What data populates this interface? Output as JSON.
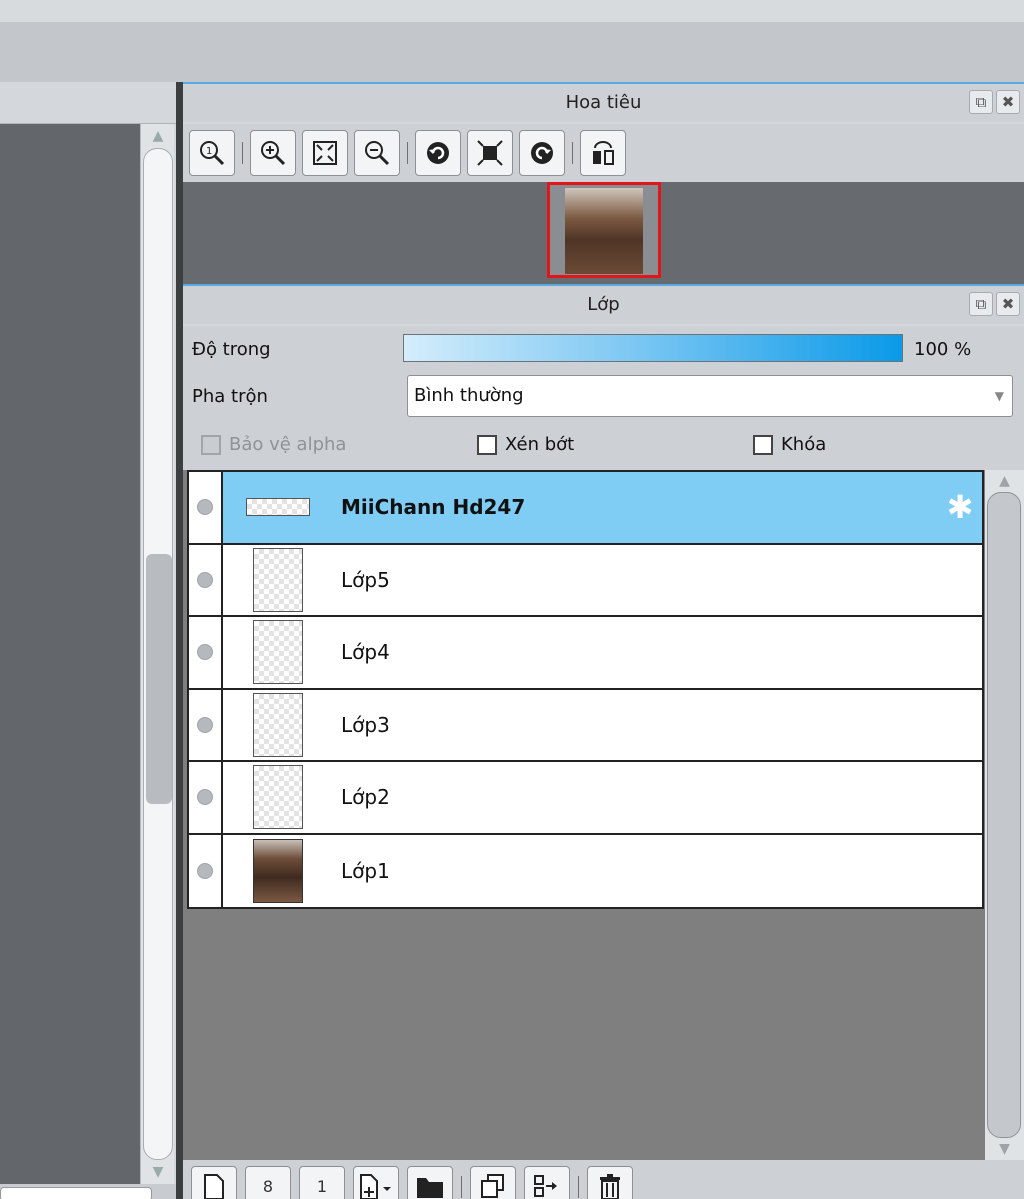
{
  "navigator": {
    "title": "Hoa tiêu",
    "toolbar": [
      "zoom-100-icon",
      "zoom-in-icon",
      "fit-window-icon",
      "zoom-out-icon",
      "rotate-left-icon",
      "fit-screen-icon",
      "rotate-right-icon",
      "flip-icon"
    ]
  },
  "layers_panel": {
    "title": "Lớp",
    "opacity_label": "Độ trong",
    "opacity_value": "100 %",
    "opacity_fraction": 1.0,
    "blend_label": "Pha trộn",
    "blend_value": "Bình thường",
    "protect_alpha_label": "Bảo vệ alpha",
    "clipping_label": "Xén bớt",
    "lock_label": "Khóa",
    "layers": [
      {
        "name": "MiiChann Hd247",
        "selected": true,
        "thumb": "wide"
      },
      {
        "name": "Lớp5",
        "selected": false,
        "thumb": "tall"
      },
      {
        "name": "Lớp4",
        "selected": false,
        "thumb": "tall"
      },
      {
        "name": "Lớp3",
        "selected": false,
        "thumb": "tall"
      },
      {
        "name": "Lớp2",
        "selected": false,
        "thumb": "tall"
      },
      {
        "name": "Lớp1",
        "selected": false,
        "thumb": "photo"
      }
    ],
    "toolbar": {
      "new_color_layer": "",
      "new_8bit_layer": "8",
      "new_1bit_layer": "1"
    }
  },
  "colors": {
    "accent": "#7fcdf5",
    "selected_layer": "#7fcdf5",
    "nav_frame": "#e0161b"
  }
}
